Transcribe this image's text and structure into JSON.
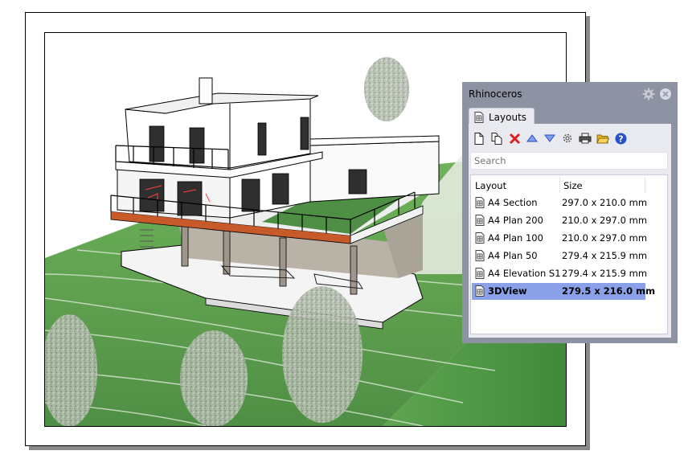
{
  "panel": {
    "title": "Rhinoceros",
    "tab_label": "Layouts",
    "toolbar": [
      {
        "name": "new-layout",
        "icon": "new-page-icon"
      },
      {
        "name": "copy-layout",
        "icon": "copy-page-icon"
      },
      {
        "name": "delete-layout",
        "icon": "delete-icon"
      },
      {
        "name": "move-up",
        "icon": "triangle-up-icon"
      },
      {
        "name": "move-down",
        "icon": "triangle-down-icon"
      },
      {
        "name": "properties",
        "icon": "gear-icon"
      },
      {
        "name": "print",
        "icon": "printer-icon"
      },
      {
        "name": "open",
        "icon": "folder-icon"
      },
      {
        "name": "help",
        "icon": "help-icon"
      }
    ],
    "search_placeholder": "Search",
    "columns": {
      "layout": "Layout",
      "size": "Size"
    },
    "rows": [
      {
        "name": "A4 Section",
        "size": "297.0 x 210.0 mm",
        "selected": false
      },
      {
        "name": "A4 Plan 200",
        "size": "210.0 x 297.0 mm",
        "selected": false
      },
      {
        "name": "A4 Plan 100",
        "size": "210.0 x 297.0 mm",
        "selected": false
      },
      {
        "name": "A4 Plan 50",
        "size": "279.4 x 215.9 mm",
        "selected": false
      },
      {
        "name": "A4 Elevation S1",
        "size": "279.4 x 215.9 mm",
        "selected": false
      },
      {
        "name": "3DView",
        "size": "279.5 x 216.0 mm",
        "selected": true
      }
    ],
    "colors": {
      "chrome": "#8e93a3",
      "selection": "#8aa1ea",
      "delete": "#e02020",
      "arrow": "#3a66d8",
      "help": "#2850c8"
    }
  },
  "scene": {
    "description": "3D rendered view of a modern two-storey house on a grassy slope",
    "colors": {
      "grass": "#5d9e4a",
      "wall": "#ffffff",
      "deck": "#c85a2a",
      "tree": "#a9b5a2"
    }
  }
}
